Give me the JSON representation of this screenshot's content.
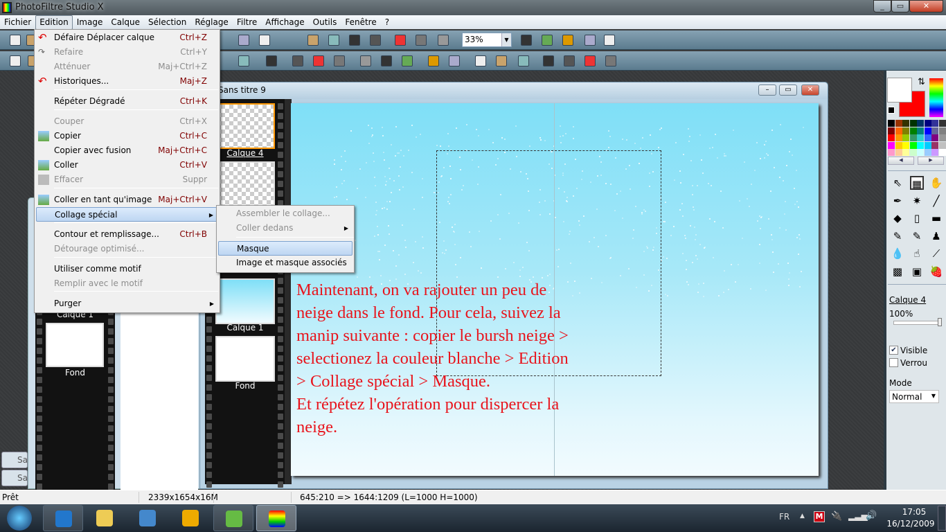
{
  "window": {
    "title": "PhotoFiltre Studio X",
    "controls": [
      "minimize",
      "maximize",
      "close"
    ]
  },
  "menubar": [
    "Fichier",
    "Edition",
    "Image",
    "Calque",
    "Sélection",
    "Réglage",
    "Filtre",
    "Affichage",
    "Outils",
    "Fenêtre",
    "?"
  ],
  "toolbar": {
    "zoom": "33%"
  },
  "edition_menu": [
    {
      "label": "Défaire Déplacer calque",
      "shortcut": "Ctrl+Z",
      "icon": "undo-icon"
    },
    {
      "label": "Refaire",
      "shortcut": "Ctrl+Y",
      "disabled": true,
      "icon": "redo-icon"
    },
    {
      "label": "Atténuer",
      "shortcut": "Maj+Ctrl+Z",
      "disabled": true
    },
    {
      "label": "Historiques...",
      "shortcut": "Maj+Z",
      "icon": "history-icon"
    },
    {
      "label": "Répéter Dégradé",
      "shortcut": "Ctrl+K"
    },
    {
      "label": "Couper",
      "shortcut": "Ctrl+X",
      "disabled": true
    },
    {
      "label": "Copier",
      "shortcut": "Ctrl+C",
      "icon": "copy-icon"
    },
    {
      "label": "Copier avec fusion",
      "shortcut": "Maj+Ctrl+C"
    },
    {
      "label": "Coller",
      "shortcut": "Ctrl+V",
      "icon": "paste-icon"
    },
    {
      "label": "Effacer",
      "shortcut": "Suppr",
      "disabled": true,
      "icon": "eraser-icon"
    },
    {
      "label": "Coller en tant qu'image",
      "shortcut": "Maj+Ctrl+V",
      "icon": "paste-as-image-icon"
    },
    {
      "label": "Collage spécial",
      "shortcut": "",
      "submenu": true,
      "highlighted": true
    },
    {
      "label": "Contour et remplissage...",
      "shortcut": "Ctrl+B"
    },
    {
      "label": "Détourage optimisé...",
      "shortcut": "",
      "disabled": true
    },
    {
      "label": "Utiliser comme motif",
      "shortcut": ""
    },
    {
      "label": "Remplir avec le motif",
      "shortcut": "",
      "disabled": true
    },
    {
      "label": "Purger",
      "shortcut": "",
      "submenu": true
    }
  ],
  "submenu": [
    {
      "label": "Assembler le collage...",
      "disabled": true
    },
    {
      "label": "Coller dedans",
      "disabled": true,
      "submenu": true
    },
    {
      "label": "Masque",
      "highlighted": true
    },
    {
      "label": "Image et masque associés"
    }
  ],
  "document": {
    "title": "Sans titre 9",
    "layers": [
      "Calque 4",
      "Calque 1",
      "Fond"
    ]
  },
  "back_document": {
    "layers": [
      "Calque 1",
      "Fond"
    ],
    "tabs": [
      "Sa",
      "Sa"
    ]
  },
  "canvas_text": [
    "Maintenant, on va rajouter un peu de",
    "neige dans le fond. Pour cela, suivez la",
    "manip suivante : copier le bursh neige >",
    "selectionez la couleur blanche > Edition",
    "> Collage spécial > Masque.",
    "Et répétez l'opération pour dispercer la",
    "neige."
  ],
  "right_panel": {
    "fg_color": "#ffffff",
    "bg_color": "#ff0000",
    "layer": "Calque 4",
    "opacity": "100%",
    "opacity_value": 100,
    "visible_label": "Visible",
    "visible": true,
    "lock_label": "Verrou",
    "lock": false,
    "mode_label": "Mode",
    "mode": "Normal",
    "palette": [
      "#000000",
      "#993300",
      "#333300",
      "#003300",
      "#003366",
      "#000080",
      "#333399",
      "#333333",
      "#800000",
      "#ff6600",
      "#808000",
      "#008000",
      "#008080",
      "#0000ff",
      "#666699",
      "#808080",
      "#ff0000",
      "#ff9900",
      "#99cc00",
      "#339966",
      "#33cccc",
      "#3366ff",
      "#800080",
      "#969696",
      "#ff00ff",
      "#ffcc00",
      "#ffff00",
      "#00ff00",
      "#00ffff",
      "#00ccff",
      "#993366",
      "#c0c0c0",
      "#ff99cc",
      "#ffcc99",
      "#ffff99",
      "#ccffcc",
      "#ccffff",
      "#99ccff",
      "#cc99ff",
      "#ffffff"
    ],
    "tools": [
      "pointer-icon",
      "selection-icon",
      "hand-icon",
      "eyedropper-icon",
      "magic-wand-icon",
      "line-icon",
      "fill-bucket-icon",
      "spray-icon",
      "eraser-icon",
      "brush-icon",
      "advanced-brush-icon",
      "clone-stamp-icon",
      "blur-drop-icon",
      "finger-smudge-icon",
      "deform-brush-icon",
      "warp-grid-icon",
      "photo-mask-icon",
      "strawberry-icon"
    ]
  },
  "status": {
    "state": "Prêt",
    "size": "2339x1654x16M",
    "selection": "645:210 => 1644:1209 (L=1000  H=1000)"
  },
  "taskbar": {
    "lang": "FR",
    "time": "17:05",
    "date": "16/12/2009",
    "apps": [
      "start-button",
      "internet-explorer-icon",
      "explorer-icon",
      "remote-desktop-icon",
      "media-player-icon",
      "messenger-icon",
      "photofiltre-studio-icon"
    ]
  }
}
